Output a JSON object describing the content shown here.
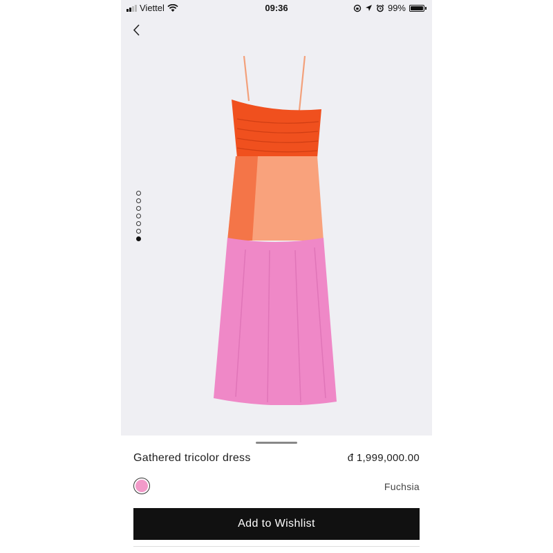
{
  "status_bar": {
    "carrier": "Viettel",
    "time": "09:36",
    "battery": "99%",
    "battery_level": 0.99
  },
  "gallery": {
    "image_count": 7,
    "active_index": 6,
    "background": "#efeff3",
    "dress_colors": {
      "top": "#f0501e",
      "middle": "#f9a27c",
      "bottom": "#ef88c7"
    }
  },
  "product": {
    "name": "Gathered tricolor dress",
    "price": "đ 1,999,000.00",
    "color_name": "Fuchsia",
    "swatch_color": "#f29ac9"
  },
  "actions": {
    "wishlist_label": "Add to Wishlist"
  }
}
